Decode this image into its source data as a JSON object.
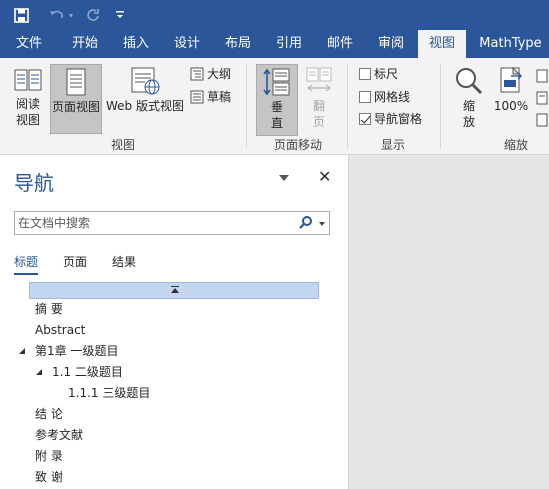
{
  "qat": {
    "save_icon": "save-icon",
    "undo_icon": "undo-icon",
    "redo_icon": "redo-icon",
    "customize_icon": "customize-qat-icon"
  },
  "tabs": [
    {
      "label": "文件"
    },
    {
      "label": "开始"
    },
    {
      "label": "插入"
    },
    {
      "label": "设计"
    },
    {
      "label": "布局"
    },
    {
      "label": "引用"
    },
    {
      "label": "邮件"
    },
    {
      "label": "审阅"
    },
    {
      "label": "视图",
      "active": true
    },
    {
      "label": "MathType"
    }
  ],
  "ribbon": {
    "view_group": {
      "label": "视图",
      "read_mode": "阅读\n视图",
      "print_layout": "页面视图",
      "web_layout": "Web 版式视图",
      "outline": "大纲",
      "draft": "草稿"
    },
    "page_movement": {
      "label": "页面移动",
      "vertical": "垂\n直",
      "side_to_side": "翻\n页"
    },
    "show": {
      "label": "显示",
      "ruler": "标尺",
      "gridlines": "网格线",
      "nav_pane": "导航窗格",
      "ruler_checked": false,
      "gridlines_checked": false,
      "nav_pane_checked": true
    },
    "zoom": {
      "label": "缩放",
      "zoom": "缩\n放",
      "hundred": "100%"
    }
  },
  "nav": {
    "title": "导航",
    "search_placeholder": "在文档中搜索",
    "tabs": [
      "标题",
      "页面",
      "结果"
    ],
    "headings": [
      {
        "text": "摘 要"
      },
      {
        "text": "Abstract"
      },
      {
        "text": "第1章 一级题目"
      },
      {
        "text": "1.1 二级题目"
      },
      {
        "text": "1.1.1 三级题目"
      },
      {
        "text": "结 论"
      },
      {
        "text": "参考文献"
      },
      {
        "text": "附 录"
      },
      {
        "text": "致 谢"
      }
    ]
  },
  "colors": {
    "accent": "#2b579a",
    "ribbon_bg": "#f3f3f3",
    "selected_btn": "#c5c5c5",
    "highlight": "#c5d6f0"
  }
}
